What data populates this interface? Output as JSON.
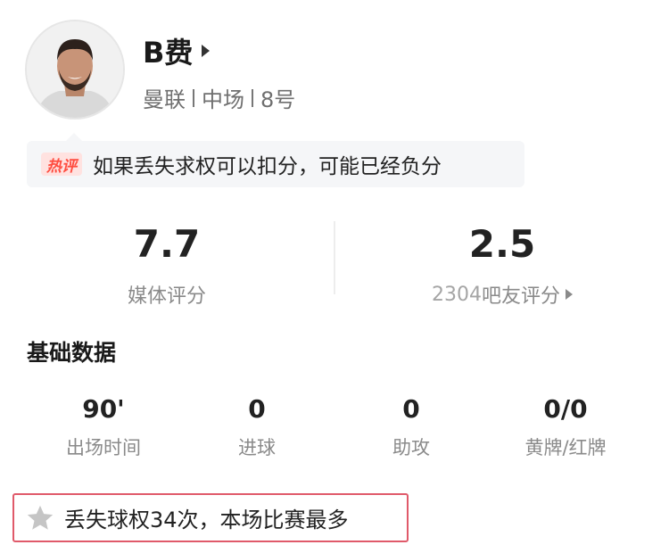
{
  "player": {
    "name": "B费",
    "team": "曼联",
    "position": "中场",
    "number": "8号"
  },
  "hot_comment": {
    "badge": "热评",
    "text": "如果丢失求权可以扣分，可能已经负分"
  },
  "ratings": {
    "media": {
      "value": "7.7",
      "label": "媒体评分"
    },
    "fan": {
      "value": "2.5",
      "count": "2304",
      "label": "吧友评分"
    }
  },
  "basic_stats": {
    "title": "基础数据",
    "items": [
      {
        "value": "90'",
        "label": "出场时间"
      },
      {
        "value": "0",
        "label": "进球"
      },
      {
        "value": "0",
        "label": "助攻"
      },
      {
        "value": "0/0",
        "label": "黄牌/红牌"
      }
    ]
  },
  "highlight": {
    "icon": "star-icon",
    "text": "丢失球权34次，本场比赛最多"
  },
  "colors": {
    "hot_badge_text": "#ff4d40",
    "hot_badge_bg": "#ffe2e0",
    "highlight_border": "#e05a6a",
    "star": "#c5c5c5"
  }
}
